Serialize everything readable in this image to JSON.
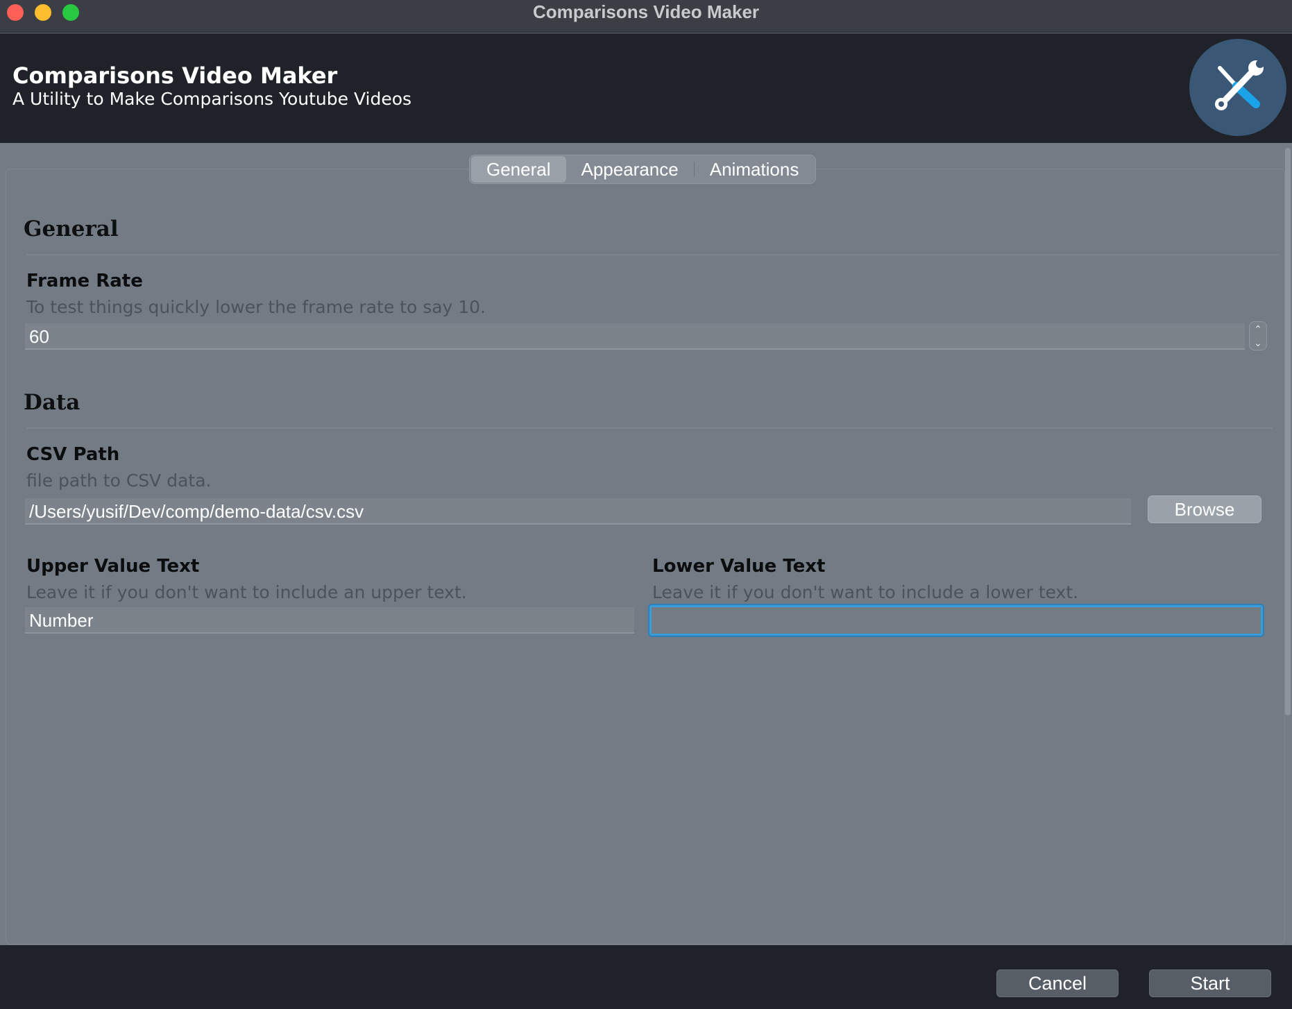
{
  "window": {
    "title": "Comparisons Video Maker"
  },
  "header": {
    "title": "Comparisons Video Maker",
    "subtitle": "A Utility to Make Comparisons Youtube Videos",
    "logo_icon": "tools-icon"
  },
  "tabs": [
    {
      "label": "General",
      "active": true
    },
    {
      "label": "Appearance",
      "active": false
    },
    {
      "label": "Animations",
      "active": false
    }
  ],
  "sections": {
    "general": {
      "title": "General",
      "frame_rate": {
        "label": "Frame Rate",
        "help": "To test things quickly lower the frame rate to say 10.",
        "value": "60"
      }
    },
    "data": {
      "title": "Data",
      "csv_path": {
        "label": "CSV Path",
        "help": "file path to CSV data.",
        "value": "/Users/yusif/Dev/comp/demo-data/csv.csv",
        "browse_label": "Browse"
      },
      "upper_value_text": {
        "label": "Upper Value Text",
        "help": "Leave it if you don't want to include an upper text.",
        "value": "Number"
      },
      "lower_value_text": {
        "label": "Lower Value Text",
        "help": "Leave it if you don't want to include a lower text.",
        "value": ""
      }
    }
  },
  "footer": {
    "cancel_label": "Cancel",
    "start_label": "Start"
  },
  "colors": {
    "header_bg": "#1f2329",
    "panel_bg": "#737b84",
    "focus_ring": "#3a9bd9",
    "logo_bg": "#3a5776",
    "logo_accent": "#1aa3e8"
  }
}
